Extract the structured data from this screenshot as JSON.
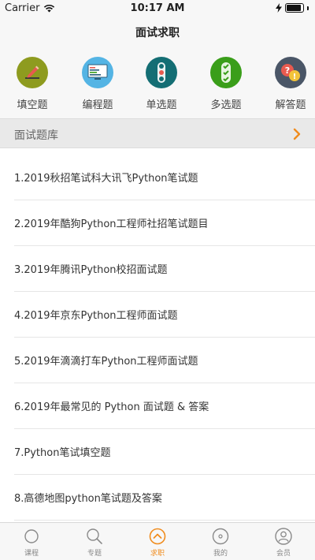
{
  "status": {
    "carrier": "Carrier",
    "time": "10:17 AM"
  },
  "nav": {
    "title": "面试求职"
  },
  "categories": [
    {
      "label": "填空题",
      "icon": "pencil-icon",
      "color": "#8e9b1f"
    },
    {
      "label": "编程题",
      "icon": "code-screen-icon",
      "color": "#54b4e4"
    },
    {
      "label": "单选题",
      "icon": "single-choice-icon",
      "color": "#146e74"
    },
    {
      "label": "多选题",
      "icon": "multi-choice-icon",
      "color": "#3a9e1a"
    },
    {
      "label": "解答题",
      "icon": "question-bubble-icon",
      "color": "#4a5667"
    }
  ],
  "section": {
    "title": "面试题库",
    "accent": "#f08c1e"
  },
  "list": [
    "1.2019秋招笔试科大讯飞Python笔试题",
    "2.2019年酷狗Python工程师社招笔试题目",
    "3.2019年腾讯Python校招面试题",
    "4.2019年京东Python工程师面试题",
    "5.2019年滴滴打车Python工程师面试题",
    "6.2019年最常见的 Python 面试题 & 答案",
    "7.Python笔试填空题",
    "8.高德地图python笔试题及答案"
  ],
  "tabs": [
    {
      "label": "课程",
      "icon": "circle-icon"
    },
    {
      "label": "专题",
      "icon": "search-icon"
    },
    {
      "label": "求职",
      "icon": "chevron-up-circle-icon",
      "active": true
    },
    {
      "label": "我的",
      "icon": "disc-icon"
    },
    {
      "label": "会员",
      "icon": "member-icon"
    }
  ]
}
